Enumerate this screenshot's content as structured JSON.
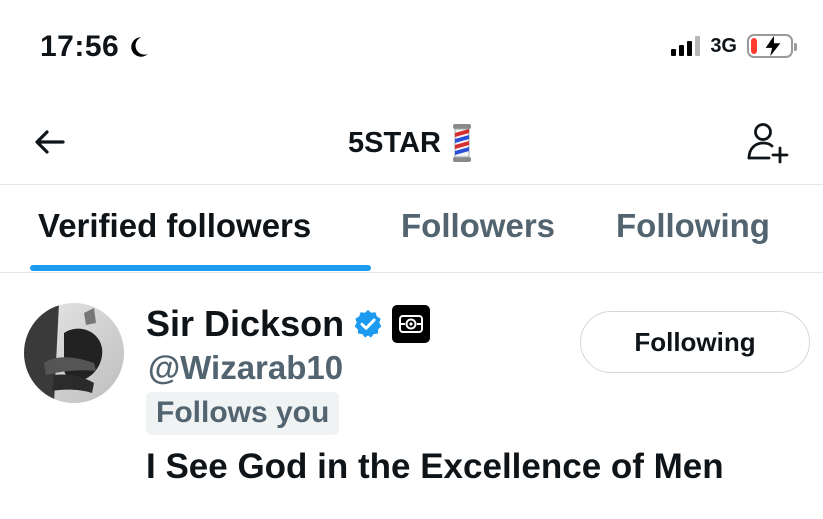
{
  "status_bar": {
    "time": "17:56",
    "network": "3G",
    "battery_level_fraction": 0.15,
    "battery_color": "#ff3b30"
  },
  "header": {
    "title": "5STAR",
    "back_icon": "arrow-left-icon",
    "title_emoji": "barber-pole-icon",
    "add_icon": "add-user-icon"
  },
  "tabs": [
    {
      "label": "Verified followers",
      "active": true
    },
    {
      "label": "Followers",
      "active": false
    },
    {
      "label": "Following",
      "active": false
    }
  ],
  "accent_color": "#1d9bf0",
  "user": {
    "name": "Sir Dickson",
    "handle": "@Wizarab10",
    "badge": "Follows you",
    "bio": "I See God in the Excellence of Men",
    "button_label": "Following",
    "verified_icon": "verified-check-icon",
    "affiliate_icon": "affiliate-badge-icon"
  }
}
